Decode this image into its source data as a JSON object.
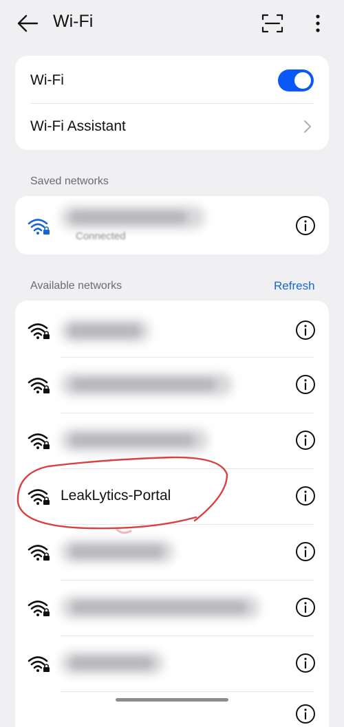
{
  "header": {
    "title": "Wi-Fi",
    "back_icon": "arrow-left-icon",
    "scan_icon": "scan-qr-icon",
    "more_icon": "more-vertical-icon"
  },
  "settings": {
    "wifi_label": "Wi-Fi",
    "wifi_enabled": true,
    "assistant_label": "Wi-Fi Assistant"
  },
  "saved_networks": {
    "title": "Saved networks",
    "items": [
      {
        "name": "",
        "status": "Connected",
        "secured": true,
        "connected": true
      }
    ]
  },
  "available_networks": {
    "title": "Available networks",
    "refresh_label": "Refresh",
    "items": [
      {
        "name": "",
        "secured": true
      },
      {
        "name": "",
        "secured": true
      },
      {
        "name": "",
        "secured": true
      },
      {
        "name": "LeakLytics-Portal",
        "secured": true
      },
      {
        "name": "",
        "secured": true
      },
      {
        "name": "",
        "secured": true
      },
      {
        "name": "",
        "secured": true
      }
    ]
  },
  "colors": {
    "accent": "#0a59f7",
    "link": "#1667d6",
    "background": "#f0f0f2",
    "annotation": "#d94040"
  }
}
